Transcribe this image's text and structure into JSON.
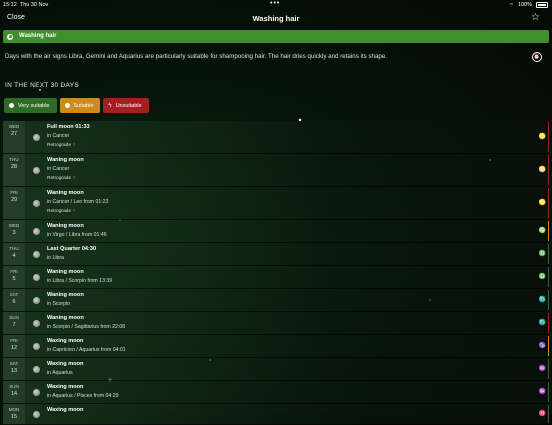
{
  "status": {
    "time": "15:12",
    "date": "Thu 30 Nov",
    "battery": "100%"
  },
  "nav": {
    "close": "Close",
    "title": "Washing hair"
  },
  "banner": {
    "label": "Washing hair"
  },
  "description": "Days with the air signs Libra, Gemini and Aquarius are particularly suitable for shampooing hair. The hair dries quickly and retains its shape.",
  "section_title": "IN THE NEXT 30 DAYS",
  "filters": [
    {
      "label": "Very suitable"
    },
    {
      "label": "Suitable"
    },
    {
      "label": "Unsuitable"
    }
  ],
  "colors": {
    "very": "#2e6b25",
    "suitable": "#d08a1c",
    "unsuitable": "#a32020",
    "banner": "#3f8f2c"
  },
  "rows": [
    {
      "dow": "WED",
      "day": "27",
      "phase": "Full moon 01:33",
      "sign": "in Cancer",
      "retro": "Retrograde",
      "icon": "cancer-icon",
      "glyph": "♋",
      "bar": "#a32020"
    },
    {
      "dow": "THU",
      "day": "28",
      "phase": "Waning moon",
      "sign": "in Cancer",
      "retro": "Retrograde",
      "icon": "cancer-icon",
      "glyph": "♋",
      "bar": "#a32020"
    },
    {
      "dow": "FRI",
      "day": "29",
      "phase": "Waning moon",
      "sign": "in Cancer / Leo from 01:23",
      "retro": "Retrograde",
      "icon": "cancer-leo-icon",
      "glyph": "♋",
      "bar": "#a32020"
    },
    {
      "dow": "WED",
      "day": "3",
      "phase": "Waning moon",
      "sign": "in Virgo / Libra from 01:46",
      "retro": "",
      "icon": "virgo-libra-icon",
      "glyph": "♍",
      "bar": "#d08a1c"
    },
    {
      "dow": "THU",
      "day": "4",
      "phase": "Last Quarter 04:30",
      "sign": "in Libra",
      "retro": "",
      "icon": "libra-icon",
      "glyph": "♎",
      "bar": "#2e6b25"
    },
    {
      "dow": "FRI",
      "day": "5",
      "phase": "Waning moon",
      "sign": "in Libra / Scorpio from 13:39",
      "retro": "",
      "icon": "libra-scorpio-icon",
      "glyph": "♎",
      "bar": "#2e6b25"
    },
    {
      "dow": "SAT",
      "day": "6",
      "phase": "Waning moon",
      "sign": "in Scorpio",
      "retro": "",
      "icon": "scorpio-icon",
      "glyph": "♏",
      "bar": "#2e6b25"
    },
    {
      "dow": "SUN",
      "day": "7",
      "phase": "Waning moon",
      "sign": "in Scorpio / Sagittarius from 22:08",
      "retro": "",
      "icon": "scorpio-sagittarius-icon",
      "glyph": "♏",
      "bar": "#a32020"
    },
    {
      "dow": "FRI",
      "day": "12",
      "phase": "Waxing moon",
      "sign": "in Capricorn / Aquarius from 04:01",
      "retro": "",
      "icon": "capricorn-aquarius-icon",
      "glyph": "♑",
      "bar": "#d08a1c"
    },
    {
      "dow": "SAT",
      "day": "13",
      "phase": "Waxing moon",
      "sign": "in Aquarius",
      "retro": "",
      "icon": "aquarius-icon",
      "glyph": "♒",
      "bar": "#2e6b25"
    },
    {
      "dow": "SUN",
      "day": "14",
      "phase": "Waxing moon",
      "sign": "in Aquarius / Pisces from 04:29",
      "retro": "",
      "icon": "aquarius-pisces-icon",
      "glyph": "♒",
      "bar": "#2e6b25"
    },
    {
      "dow": "MON",
      "day": "15",
      "phase": "Waxing moon",
      "sign": "",
      "retro": "",
      "icon": "pisces-icon",
      "glyph": "♓",
      "bar": "#2e6b25"
    }
  ]
}
